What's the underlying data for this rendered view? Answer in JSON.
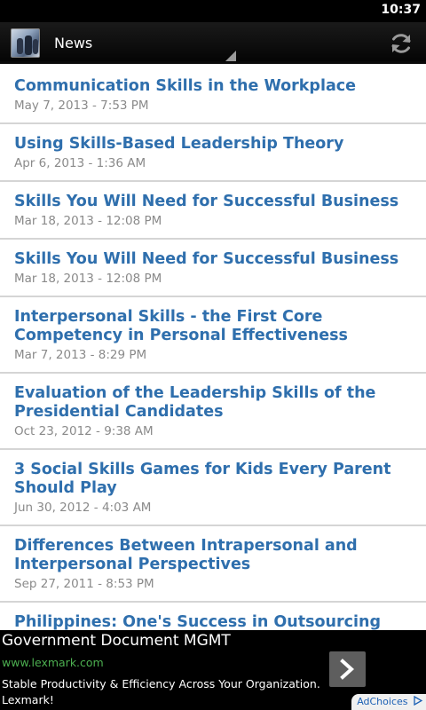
{
  "status_bar": {
    "time": "10:37"
  },
  "action_bar": {
    "title": "News"
  },
  "news": [
    {
      "title": "Communication Skills in the Workplace",
      "date": "May 7, 2013 - 7:53 PM"
    },
    {
      "title": "Using Skills-Based Leadership Theory",
      "date": "Apr 6, 2013 - 1:36 AM"
    },
    {
      "title": "Skills You Will Need for Successful Business",
      "date": "Mar 18, 2013 - 12:08 PM"
    },
    {
      "title": "Skills You Will Need for Successful Business",
      "date": "Mar 18, 2013 - 12:08 PM"
    },
    {
      "title": "Interpersonal Skills - the First Core Competency in Personal Effectiveness",
      "date": "Mar 7, 2013 - 8:29 PM"
    },
    {
      "title": "Evaluation of the Leadership Skills of the Presidential Candidates",
      "date": "Oct 23, 2012 - 9:38 AM"
    },
    {
      "title": "3 Social Skills Games for Kids Every Parent Should Play",
      "date": "Jun 30, 2012 - 4:03 AM"
    },
    {
      "title": "Differences Between Intrapersonal and Interpersonal Perspectives",
      "date": "Sep 27, 2011 - 8:53 PM"
    },
    {
      "title": "Philippines: One's Success in Outsourcing Industry",
      "date": ""
    }
  ],
  "ad": {
    "title": "Government Document MGMT",
    "url": "www.lexmark.com",
    "description": "Stable Productivity & Efficiency Across Your Organization. Lexmark!",
    "adchoices_label": "AdChoices"
  },
  "icons": {
    "app_logo": "app-logo-icon",
    "spinner": "spinner-arrow-icon",
    "refresh": "refresh-icon",
    "ad_arrow": "chevron-right-icon",
    "adchoices": "adchoices-icon"
  },
  "colors": {
    "title_blue": "#2f6fad",
    "date_gray": "#8a8a8a",
    "ad_url_green": "#4caf50"
  }
}
